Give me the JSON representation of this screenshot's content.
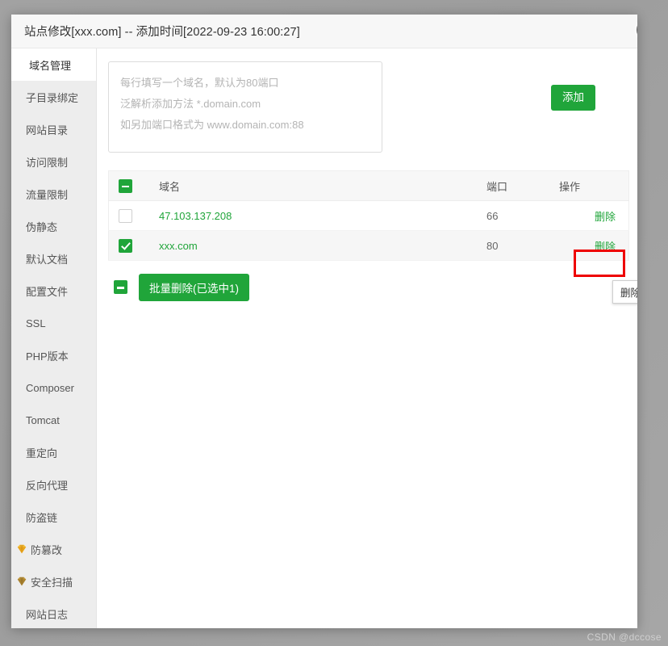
{
  "window": {
    "title": "站点修改[xxx.com] -- 添加时间[2022-09-23 16:00:27]",
    "close_icon": "close-circle-icon"
  },
  "sidebar": {
    "items": [
      {
        "label": "域名管理",
        "active": true,
        "icon": null
      },
      {
        "label": "子目录绑定",
        "active": false,
        "icon": null
      },
      {
        "label": "网站目录",
        "active": false,
        "icon": null
      },
      {
        "label": "访问限制",
        "active": false,
        "icon": null
      },
      {
        "label": "流量限制",
        "active": false,
        "icon": null
      },
      {
        "label": "伪静态",
        "active": false,
        "icon": null
      },
      {
        "label": "默认文档",
        "active": false,
        "icon": null
      },
      {
        "label": "配置文件",
        "active": false,
        "icon": null
      },
      {
        "label": "SSL",
        "active": false,
        "icon": null
      },
      {
        "label": "PHP版本",
        "active": false,
        "icon": null
      },
      {
        "label": "Composer",
        "active": false,
        "icon": null
      },
      {
        "label": "Tomcat",
        "active": false,
        "icon": null
      },
      {
        "label": "重定向",
        "active": false,
        "icon": null
      },
      {
        "label": "反向代理",
        "active": false,
        "icon": null
      },
      {
        "label": "防盗链",
        "active": false,
        "icon": null
      },
      {
        "label": "防篡改",
        "active": false,
        "icon": "gem-icon"
      },
      {
        "label": "安全扫描",
        "active": false,
        "icon": "gem-icon"
      },
      {
        "label": "网站日志",
        "active": false,
        "icon": null
      }
    ]
  },
  "add_panel": {
    "textarea_value": "",
    "textarea_placeholder": "每行填写一个域名，默认为80端口\n泛解析添加方法 *.domain.com\n如另加端口格式为 www.domain.com:88",
    "add_button_label": "添加"
  },
  "table": {
    "header_checkbox_state": "indeterminate",
    "columns": [
      "域名",
      "端口",
      "操作"
    ],
    "rows": [
      {
        "checked": false,
        "domain": "47.103.137.208",
        "port": "66",
        "action_label": "删除",
        "selected": false
      },
      {
        "checked": true,
        "domain": "xxx.com",
        "port": "80",
        "action_label": "删除",
        "selected": true
      }
    ]
  },
  "tooltip": {
    "text": "删除"
  },
  "batch": {
    "checkbox_state": "indeterminate",
    "button_label": "批量删除(已选中1)"
  },
  "watermark": {
    "text": "CSDN @dccose"
  },
  "colors": {
    "accent_green": "#20a53a",
    "highlight_red": "#ee0000",
    "sidebar_bg": "#ededed",
    "title_bg": "#f7f7f7",
    "backdrop": "#9f9f9f"
  }
}
